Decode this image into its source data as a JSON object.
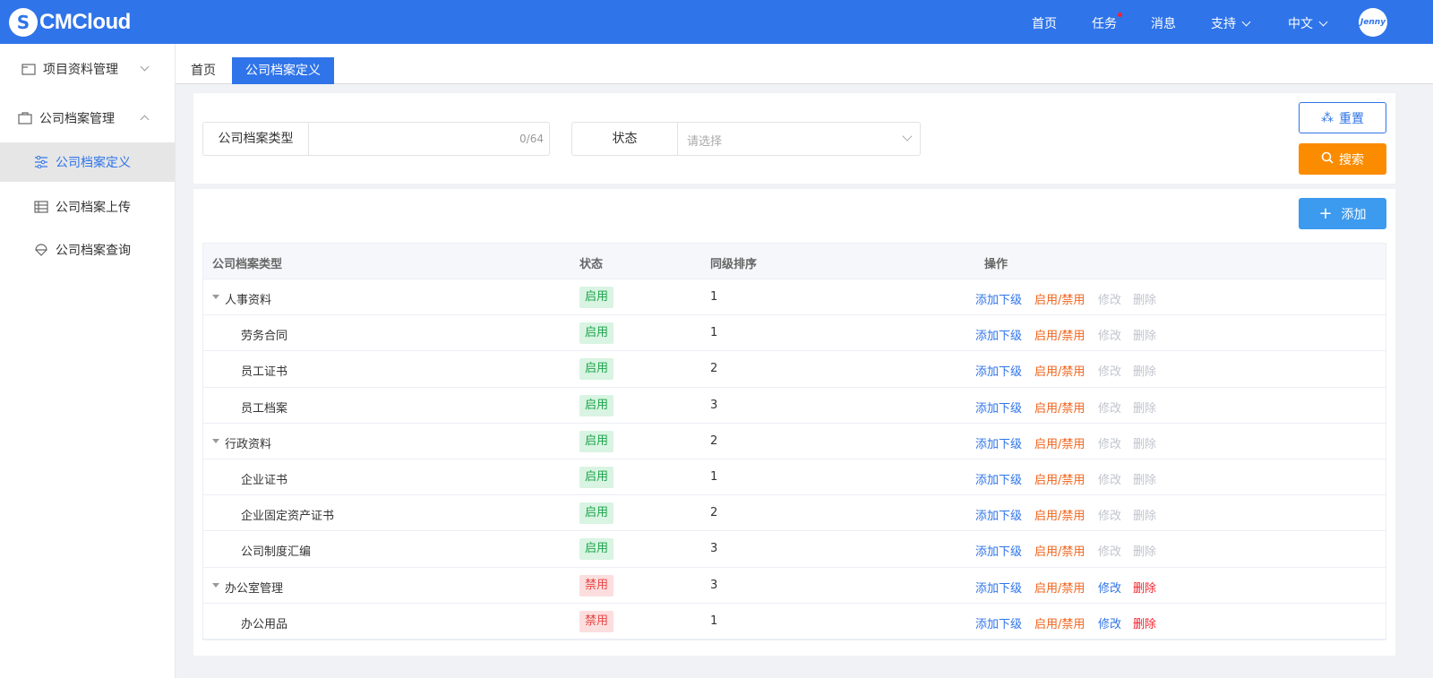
{
  "header": {
    "logo_text": "CMCloud",
    "nav": {
      "home": "首页",
      "tasks": "任务",
      "messages": "消息",
      "support": "支持",
      "language": "中文"
    },
    "avatar_text": "Jenny",
    "brand_color": "#2f74e9"
  },
  "sidebar": {
    "items": [
      {
        "label": "项目资料管理"
      },
      {
        "label": "公司档案管理"
      },
      {
        "label": "公司档案定义"
      },
      {
        "label": "公司档案上传"
      },
      {
        "label": "公司档案查询"
      }
    ]
  },
  "tabs": [
    {
      "label": "首页"
    },
    {
      "label": "公司档案定义"
    }
  ],
  "filter": {
    "type_label": "公司档案类型",
    "type_value": "",
    "type_count": "0/64",
    "status_label": "状态",
    "status_placeholder": "请选择",
    "reset_label": "重置",
    "search_label": "搜索"
  },
  "toolbar": {
    "add_label": "添加"
  },
  "table": {
    "columns": [
      "公司档案类型",
      "状态",
      "同级排序",
      "操作"
    ],
    "actions": {
      "add_child": "添加下级",
      "toggle": "启用/禁用",
      "edit": "修改",
      "delete": "删除"
    },
    "rows": [
      {
        "name": "人事资料",
        "status": "启用",
        "order": "1"
      },
      {
        "name": "劳务合同",
        "status": "启用",
        "order": "1"
      },
      {
        "name": "员工证书",
        "status": "启用",
        "order": "2"
      },
      {
        "name": "员工档案",
        "status": "启用",
        "order": "3"
      },
      {
        "name": "行政资料",
        "status": "启用",
        "order": "2"
      },
      {
        "name": "企业证书",
        "status": "启用",
        "order": "1"
      },
      {
        "name": "企业固定资产证书",
        "status": "启用",
        "order": "2"
      },
      {
        "name": "公司制度汇编",
        "status": "启用",
        "order": "3"
      },
      {
        "name": "办公室管理",
        "status": "禁用",
        "order": "3"
      },
      {
        "name": "办公用品",
        "status": "禁用",
        "order": "1"
      }
    ]
  }
}
